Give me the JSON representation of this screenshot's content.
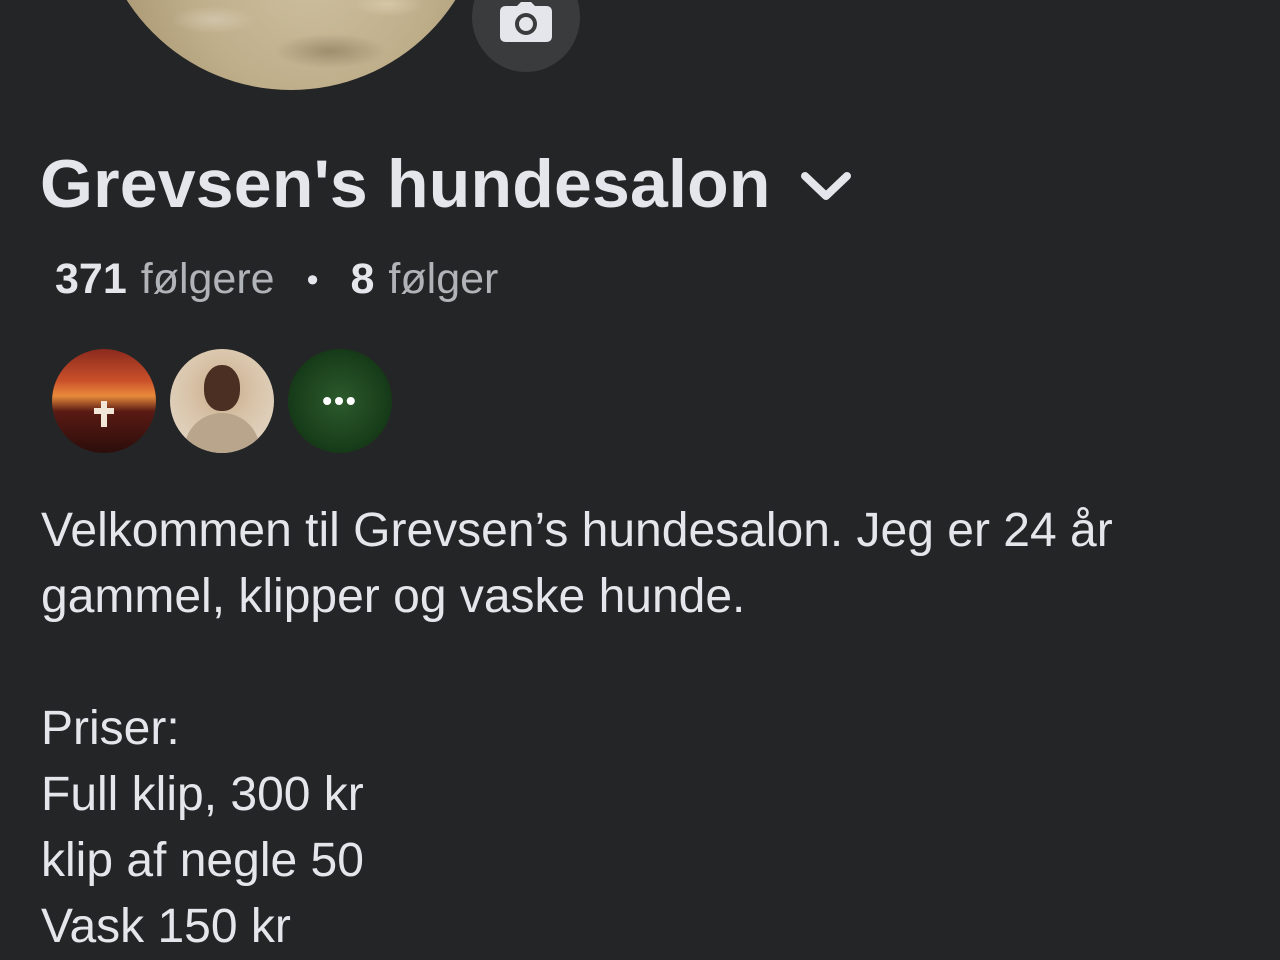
{
  "profile": {
    "name": "Grevsen's hundesalon",
    "followers_count": "371",
    "followers_label": "følgere",
    "following_count": "8",
    "following_label": "følger"
  },
  "icons": {
    "camera": "camera-icon",
    "chevron": "chevron-down-icon",
    "more": "more-dots-icon"
  },
  "bio": {
    "intro": "Velkommen til Grevsen’s hundesalon. Jeg er 24 år gammel, klipper og vaske hunde.",
    "prices_heading": "Priser:",
    "price_lines": [
      "Full klip, 300 kr",
      "klip af negle 50",
      "Vask 150 kr"
    ]
  },
  "colors": {
    "background": "#242526",
    "primary_text": "#e4e6eb",
    "secondary_text": "#b0b3b8",
    "button_bg": "#3a3b3c"
  }
}
